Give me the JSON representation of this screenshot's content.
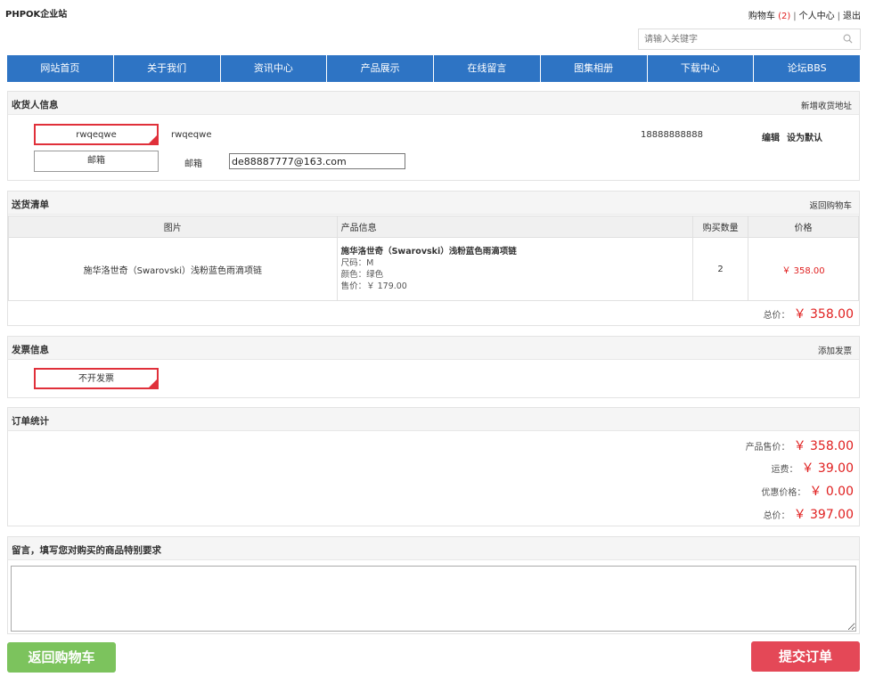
{
  "site": {
    "title": "PHPOK企业站"
  },
  "top_links": {
    "cart_label": "购物车",
    "cart_count": "(2)",
    "user_center": "个人中心",
    "logout": "退出",
    "sep": "|"
  },
  "search": {
    "placeholder": "请输入关键字",
    "value": ""
  },
  "nav": [
    {
      "label": "网站首页"
    },
    {
      "label": "关于我们"
    },
    {
      "label": "资讯中心"
    },
    {
      "label": "产品展示"
    },
    {
      "label": "在线留言"
    },
    {
      "label": "图集相册"
    },
    {
      "label": "下载中心"
    },
    {
      "label": "论坛BBS"
    }
  ],
  "receiver": {
    "title": "收货人信息",
    "add_link": "新增收货地址",
    "selected_box": "rwqeqwe",
    "name": "rwqeqwe",
    "phone": "18888888888",
    "edit": "编辑",
    "set_default": "设为默认",
    "email_box": "邮箱",
    "email_label": "邮箱",
    "email_value": "de88887777@163.com"
  },
  "goods": {
    "title": "送货清单",
    "back_link": "返回购物车",
    "headers": {
      "image": "图片",
      "info": "产品信息",
      "qty": "购买数量",
      "price": "价格"
    },
    "items": [
      {
        "image_alt": "施华洛世奇（Swarovski）浅粉蓝色雨滴项链",
        "name": "施华洛世奇（Swarovski）浅粉蓝色雨滴项链",
        "size": "尺码：M",
        "color": "颜色：绿色",
        "unit_price": "售价：￥ 179.00",
        "qty": "2",
        "price": "￥ 358.00"
      }
    ],
    "total_label": "总价：",
    "total_value": "￥ 358.00"
  },
  "invoice": {
    "title": "发票信息",
    "add_link": "添加发票",
    "option": "不开发票"
  },
  "stats": {
    "title": "订单统计",
    "rows": [
      {
        "label": "产品售价：",
        "value": "￥ 358.00"
      },
      {
        "label": "运费：",
        "value": "￥ 39.00"
      },
      {
        "label": "优惠价格：",
        "value": "￥ 0.00"
      },
      {
        "label": "总价：",
        "value": "￥ 397.00"
      }
    ]
  },
  "remark": {
    "title": "留言，填写您对购买的商品特别要求",
    "value": ""
  },
  "buttons": {
    "back": "返回购物车",
    "submit": "提交订单"
  },
  "colors": {
    "nav": "#2e74c4",
    "accent_red": "#e02020",
    "back_btn": "#7cc35d",
    "submit_btn": "#e44857"
  }
}
